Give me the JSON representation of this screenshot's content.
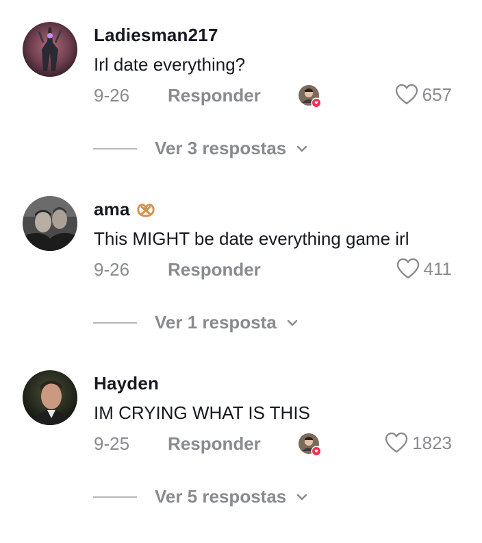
{
  "comments": [
    {
      "username": "Ladiesman217",
      "username_emoji": "",
      "text": "Irl date everything?",
      "date": "9-26",
      "reply_label": "Responder",
      "creator_liked": true,
      "likes": "657",
      "view_replies_label": "Ver 3 respostas"
    },
    {
      "username": "ama",
      "username_emoji": "pretzel-icon",
      "text": "This MIGHT be date everything game irl",
      "date": "9-26",
      "reply_label": "Responder",
      "creator_liked": false,
      "likes": "411",
      "view_replies_label": "Ver 1 resposta"
    },
    {
      "username": "Hayden",
      "username_emoji": "",
      "text": "IM CRYING WHAT IS THIS",
      "date": "9-25",
      "reply_label": "Responder",
      "creator_liked": true,
      "likes": "1823",
      "view_replies_label": "Ver 5 respostas"
    }
  ],
  "colors": {
    "primary_text": "#161823",
    "secondary_text": "#8a8b91",
    "divider": "#b5b6ba",
    "like_badge": "#fe2c55"
  }
}
